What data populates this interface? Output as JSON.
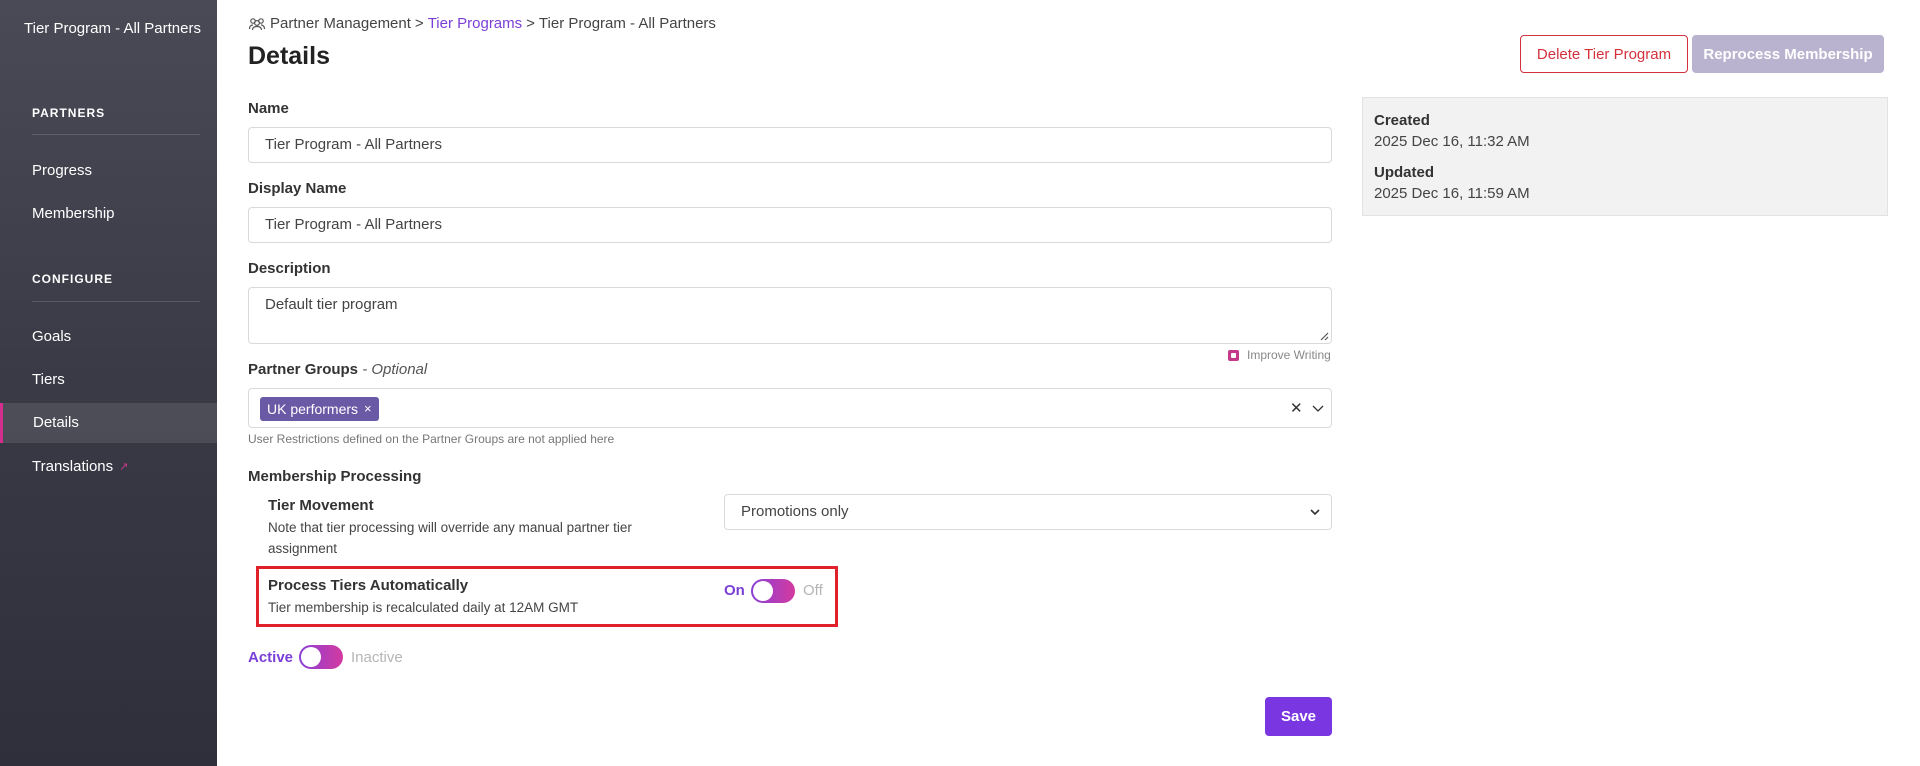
{
  "sidebar": {
    "title": "Tier Program - All Partners",
    "sections": [
      {
        "label": "PARTNERS",
        "items": [
          {
            "label": "Progress"
          },
          {
            "label": "Membership"
          }
        ]
      },
      {
        "label": "CONFIGURE",
        "items": [
          {
            "label": "Goals"
          },
          {
            "label": "Tiers"
          },
          {
            "label": "Details"
          },
          {
            "label": "Translations"
          }
        ]
      }
    ],
    "active_item": "Details"
  },
  "breadcrumb": {
    "root": "Partner Management",
    "separator": ">",
    "link": "Tier Programs",
    "current": "Tier Program - All Partners"
  },
  "page": {
    "title": "Details"
  },
  "actions": {
    "delete_label": "Delete Tier Program",
    "reprocess_label": "Reprocess Membership"
  },
  "info": {
    "created_label": "Created",
    "created_value": "2025 Dec 16, 11:32 AM",
    "updated_label": "Updated",
    "updated_value": "2025 Dec 16, 11:59 AM"
  },
  "form": {
    "name_label": "Name",
    "name_value": "Tier Program - All Partners",
    "display_name_label": "Display Name",
    "display_name_value": "Tier Program - All Partners",
    "description_label": "Description",
    "description_value": "Default tier program",
    "improve_writing": "Improve Writing",
    "partner_groups_label": "Partner Groups",
    "partner_groups_optional": "- Optional",
    "partner_groups_chips": [
      "UK performers"
    ],
    "partner_groups_hint": "User Restrictions defined on the Partner Groups are not applied here",
    "membership_processing_label": "Membership Processing",
    "tier_movement_label": "Tier Movement",
    "tier_movement_desc": "Note that tier processing will override any manual partner tier assignment",
    "tier_movement_value": "Promotions only",
    "process_auto_label": "Process Tiers Automatically",
    "process_auto_desc": "Tier membership is recalculated daily at 12AM GMT",
    "process_auto_on": "On",
    "process_auto_off": "Off",
    "active_on": "Active",
    "active_off": "Inactive",
    "save_label": "Save"
  },
  "colors": {
    "accent": "#7a3fd6",
    "danger": "#d3313c",
    "highlight": "#e0202a"
  }
}
